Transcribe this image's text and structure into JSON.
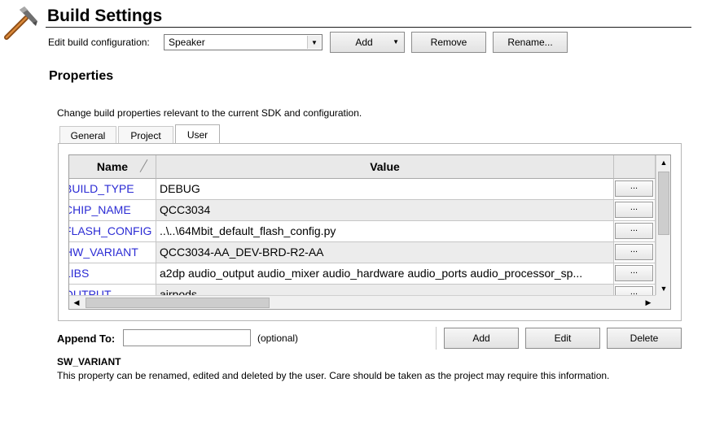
{
  "header": {
    "title": "Build Settings",
    "icon": "hammer-icon"
  },
  "config": {
    "label": "Edit build configuration:",
    "selected": "Speaker",
    "add_label": "Add",
    "remove_label": "Remove",
    "rename_label": "Rename..."
  },
  "properties": {
    "heading": "Properties",
    "description": "Change build properties relevant to the current SDK and configuration.",
    "tabs": [
      {
        "label": "General"
      },
      {
        "label": "Project"
      },
      {
        "label": "User",
        "active": true
      }
    ]
  },
  "grid": {
    "columns": {
      "name": "Name",
      "value": "Value"
    },
    "ellipsis": "...",
    "rows": [
      {
        "name": "BUILD_TYPE",
        "value": "DEBUG"
      },
      {
        "name": "CHIP_NAME",
        "value": "QCC3034"
      },
      {
        "name": "FLASH_CONFIG",
        "value": "..\\..\\64Mbit_default_flash_config.py"
      },
      {
        "name": "HW_VARIANT",
        "value": "QCC3034-AA_DEV-BRD-R2-AA"
      },
      {
        "name": "LIBS",
        "value": "a2dp audio_output audio_mixer audio_hardware audio_ports audio_processor_sp..."
      },
      {
        "name": "OUTPUT",
        "value": "airpods"
      }
    ]
  },
  "append": {
    "label": "Append To:",
    "value": "",
    "optional": "(optional)",
    "add_label": "Add",
    "edit_label": "Edit",
    "delete_label": "Delete"
  },
  "selected_property": {
    "name": "SW_VARIANT",
    "description": "This property can be renamed, edited and deleted by the user. Care should be taken as the project may require this information."
  },
  "colors": {
    "link": "#2b2bd4",
    "row_alt": "#ececec"
  }
}
